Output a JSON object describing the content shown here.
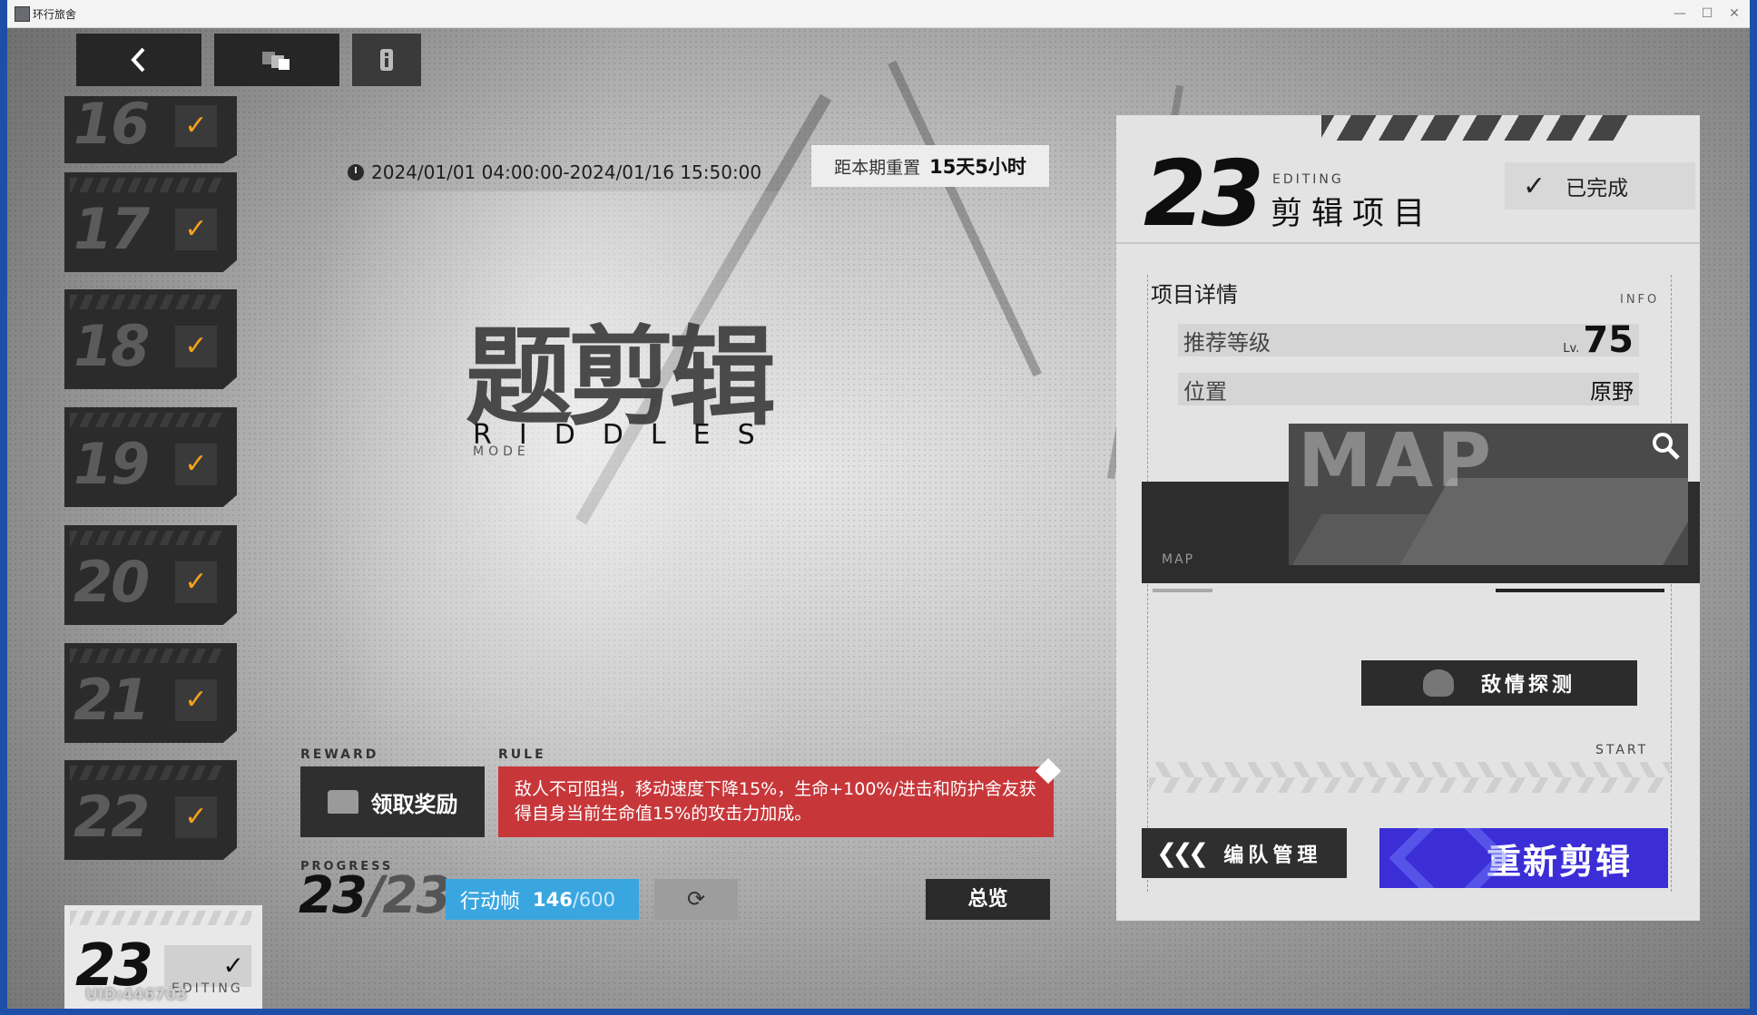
{
  "window": {
    "title": "环行旅舍",
    "controls": [
      "—",
      "☐",
      "✕"
    ]
  },
  "nav": {
    "back_icon": "chevron-left-icon",
    "share_icon": "cubes-icon",
    "info_icon": "info-icon"
  },
  "levels": [
    {
      "number": "16",
      "completed": true
    },
    {
      "number": "17",
      "completed": true
    },
    {
      "number": "18",
      "completed": true
    },
    {
      "number": "19",
      "completed": true
    },
    {
      "number": "20",
      "completed": true
    },
    {
      "number": "21",
      "completed": true
    },
    {
      "number": "22",
      "completed": true
    }
  ],
  "current_level": {
    "number": "23",
    "check": "✓",
    "label": "EDITING"
  },
  "uid": "UID:446703",
  "event": {
    "date_range": "2024/01/01 04:00:00-2024/01/16 15:50:00",
    "reset_label": "距本期重置",
    "reset_value": "15天5小时"
  },
  "mode": {
    "title_cn": "题剪辑",
    "title_en": "RIDDLES",
    "mode_label": "MODE"
  },
  "reward": {
    "section_label": "REWARD",
    "button_label": "领取奖励"
  },
  "rule": {
    "section_label": "RULE",
    "text": "敌人不可阻挡，移动速度下降15%，生命+100%/进击和防护舍友获得自身当前生命值15%的攻击力加成。"
  },
  "progress": {
    "section_label": "PROGRESS",
    "current": "23",
    "separator": "/",
    "total": "23"
  },
  "action_frames": {
    "label": "行动帧",
    "current": "146",
    "max": "/600"
  },
  "overview_label": "总览",
  "panel": {
    "number": "23",
    "editing_label": "EDITING",
    "title": "剪辑项目",
    "status": "已完成",
    "section_title": "项目详情",
    "info_label": "INFO",
    "rows": [
      {
        "label": "推荐等级",
        "prefix": "Lv.",
        "value": "75"
      },
      {
        "label": "位置",
        "value": "原野"
      }
    ],
    "map_label": "MAP",
    "map_tag": "MAP",
    "detect_label": "敌情探测",
    "start_label": "START",
    "team_label": "编队管理",
    "reedit_label": "重新剪辑"
  },
  "colors": {
    "accent_orange": "#f4a21a",
    "rule_red": "#c7373a",
    "action_blue": "#3aa6e0",
    "reedit_blue": "#3b2ed6"
  }
}
